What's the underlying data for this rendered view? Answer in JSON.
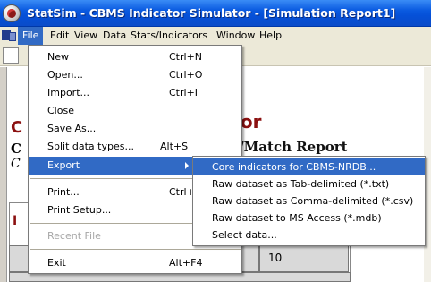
{
  "window": {
    "title": "StatSim - CBMS Indicator Simulator - [Simulation Report1]"
  },
  "menubar": {
    "items": [
      "File",
      "Edit",
      "View",
      "Data",
      "Stats/Indicators",
      "Window",
      "Help"
    ],
    "active": "File"
  },
  "document": {
    "title_fragment": "imulator",
    "subtitle_fragment": "r Merge/Match Report",
    "left_fragments": [
      "C",
      "C",
      "C",
      "I"
    ],
    "table_value": "10"
  },
  "file_menu": {
    "items": [
      {
        "label": "New",
        "shortcut": "Ctrl+N"
      },
      {
        "label": "Open...",
        "shortcut": "Ctrl+O"
      },
      {
        "label": "Import...",
        "shortcut": "Ctrl+I"
      },
      {
        "label": "Close",
        "shortcut": ""
      },
      {
        "label": "Save As...",
        "shortcut": ""
      },
      {
        "label": "Split data types...",
        "shortcut": "Alt+S"
      },
      {
        "label": "Export",
        "shortcut": "",
        "submenu": true,
        "highlighted": true
      },
      {
        "label": "Print...",
        "shortcut": "Ctrl+P"
      },
      {
        "label": "Print Setup...",
        "shortcut": ""
      },
      {
        "label": "Recent File",
        "shortcut": "",
        "disabled": true
      },
      {
        "label": "Exit",
        "shortcut": "Alt+F4"
      }
    ]
  },
  "export_submenu": {
    "items": [
      {
        "label": "Core indicators for CBMS-NRDB...",
        "highlighted": true
      },
      {
        "label": "Raw dataset as Tab-delimited (*.txt)"
      },
      {
        "label": "Raw dataset as Comma-delimited (*.csv)"
      },
      {
        "label": "Raw dataset to MS Access (*.mdb)"
      },
      {
        "label": "Select data..."
      }
    ]
  },
  "colors": {
    "titlebar": "#0a5ae0",
    "highlight": "#316ac5",
    "report_title": "#8b1010",
    "chrome": "#ece9d8"
  }
}
